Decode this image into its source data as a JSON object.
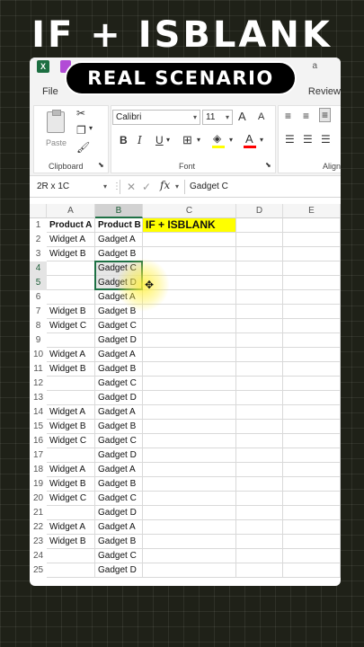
{
  "overlay": {
    "headline": "IF + ISBLANK",
    "badge": "REAL SCENARIO"
  },
  "titlebar": {
    "app_icon": "excel-icon",
    "right_text": "a"
  },
  "menu": {
    "file": "File",
    "review": "Review"
  },
  "ribbon": {
    "clipboard_label": "Clipboard",
    "paste_label": "Paste",
    "font_label": "Font",
    "alignment_label": "Align",
    "font_name": "Calibri",
    "font_size": "11",
    "bold": "B",
    "italic": "I",
    "underline": "U",
    "grow_font": "A",
    "shrink_font": "A",
    "font_color_glyph": "A",
    "fill_color": "#ffff00",
    "font_color": "#ff0000"
  },
  "formula_bar": {
    "name_box": "2R x 1C",
    "fx": "fx",
    "value": "Gadget C"
  },
  "sheet": {
    "columns": [
      "A",
      "B",
      "C",
      "D",
      "E"
    ],
    "selected_column": "B",
    "selected_rows": [
      4,
      5
    ],
    "header_row": [
      "Product A",
      "Product B",
      "IF + ISBLANK"
    ],
    "rows": [
      [
        "Widget A",
        "Gadget A"
      ],
      [
        "Widget B",
        "Gadget B"
      ],
      [
        "",
        "Gadget C"
      ],
      [
        "",
        "Gadget D"
      ],
      [
        "",
        "Gadget A"
      ],
      [
        "Widget B",
        "Gadget B"
      ],
      [
        "Widget C",
        "Gadget C"
      ],
      [
        "",
        "Gadget D"
      ],
      [
        "Widget A",
        "Gadget A"
      ],
      [
        "Widget B",
        "Gadget B"
      ],
      [
        "",
        "Gadget C"
      ],
      [
        "",
        "Gadget D"
      ],
      [
        "Widget A",
        "Gadget A"
      ],
      [
        "Widget B",
        "Gadget B"
      ],
      [
        "Widget C",
        "Gadget C"
      ],
      [
        "",
        "Gadget D"
      ],
      [
        "Widget A",
        "Gadget A"
      ],
      [
        "Widget B",
        "Gadget B"
      ],
      [
        "Widget C",
        "Gadget C"
      ],
      [
        "",
        "Gadget D"
      ],
      [
        "Widget A",
        "Gadget A"
      ],
      [
        "Widget B",
        "Gadget B"
      ],
      [
        "",
        "Gadget C"
      ],
      [
        "",
        "Gadget D"
      ]
    ],
    "highlight_color": "#ffff00",
    "selection_color": "#1e7145"
  }
}
